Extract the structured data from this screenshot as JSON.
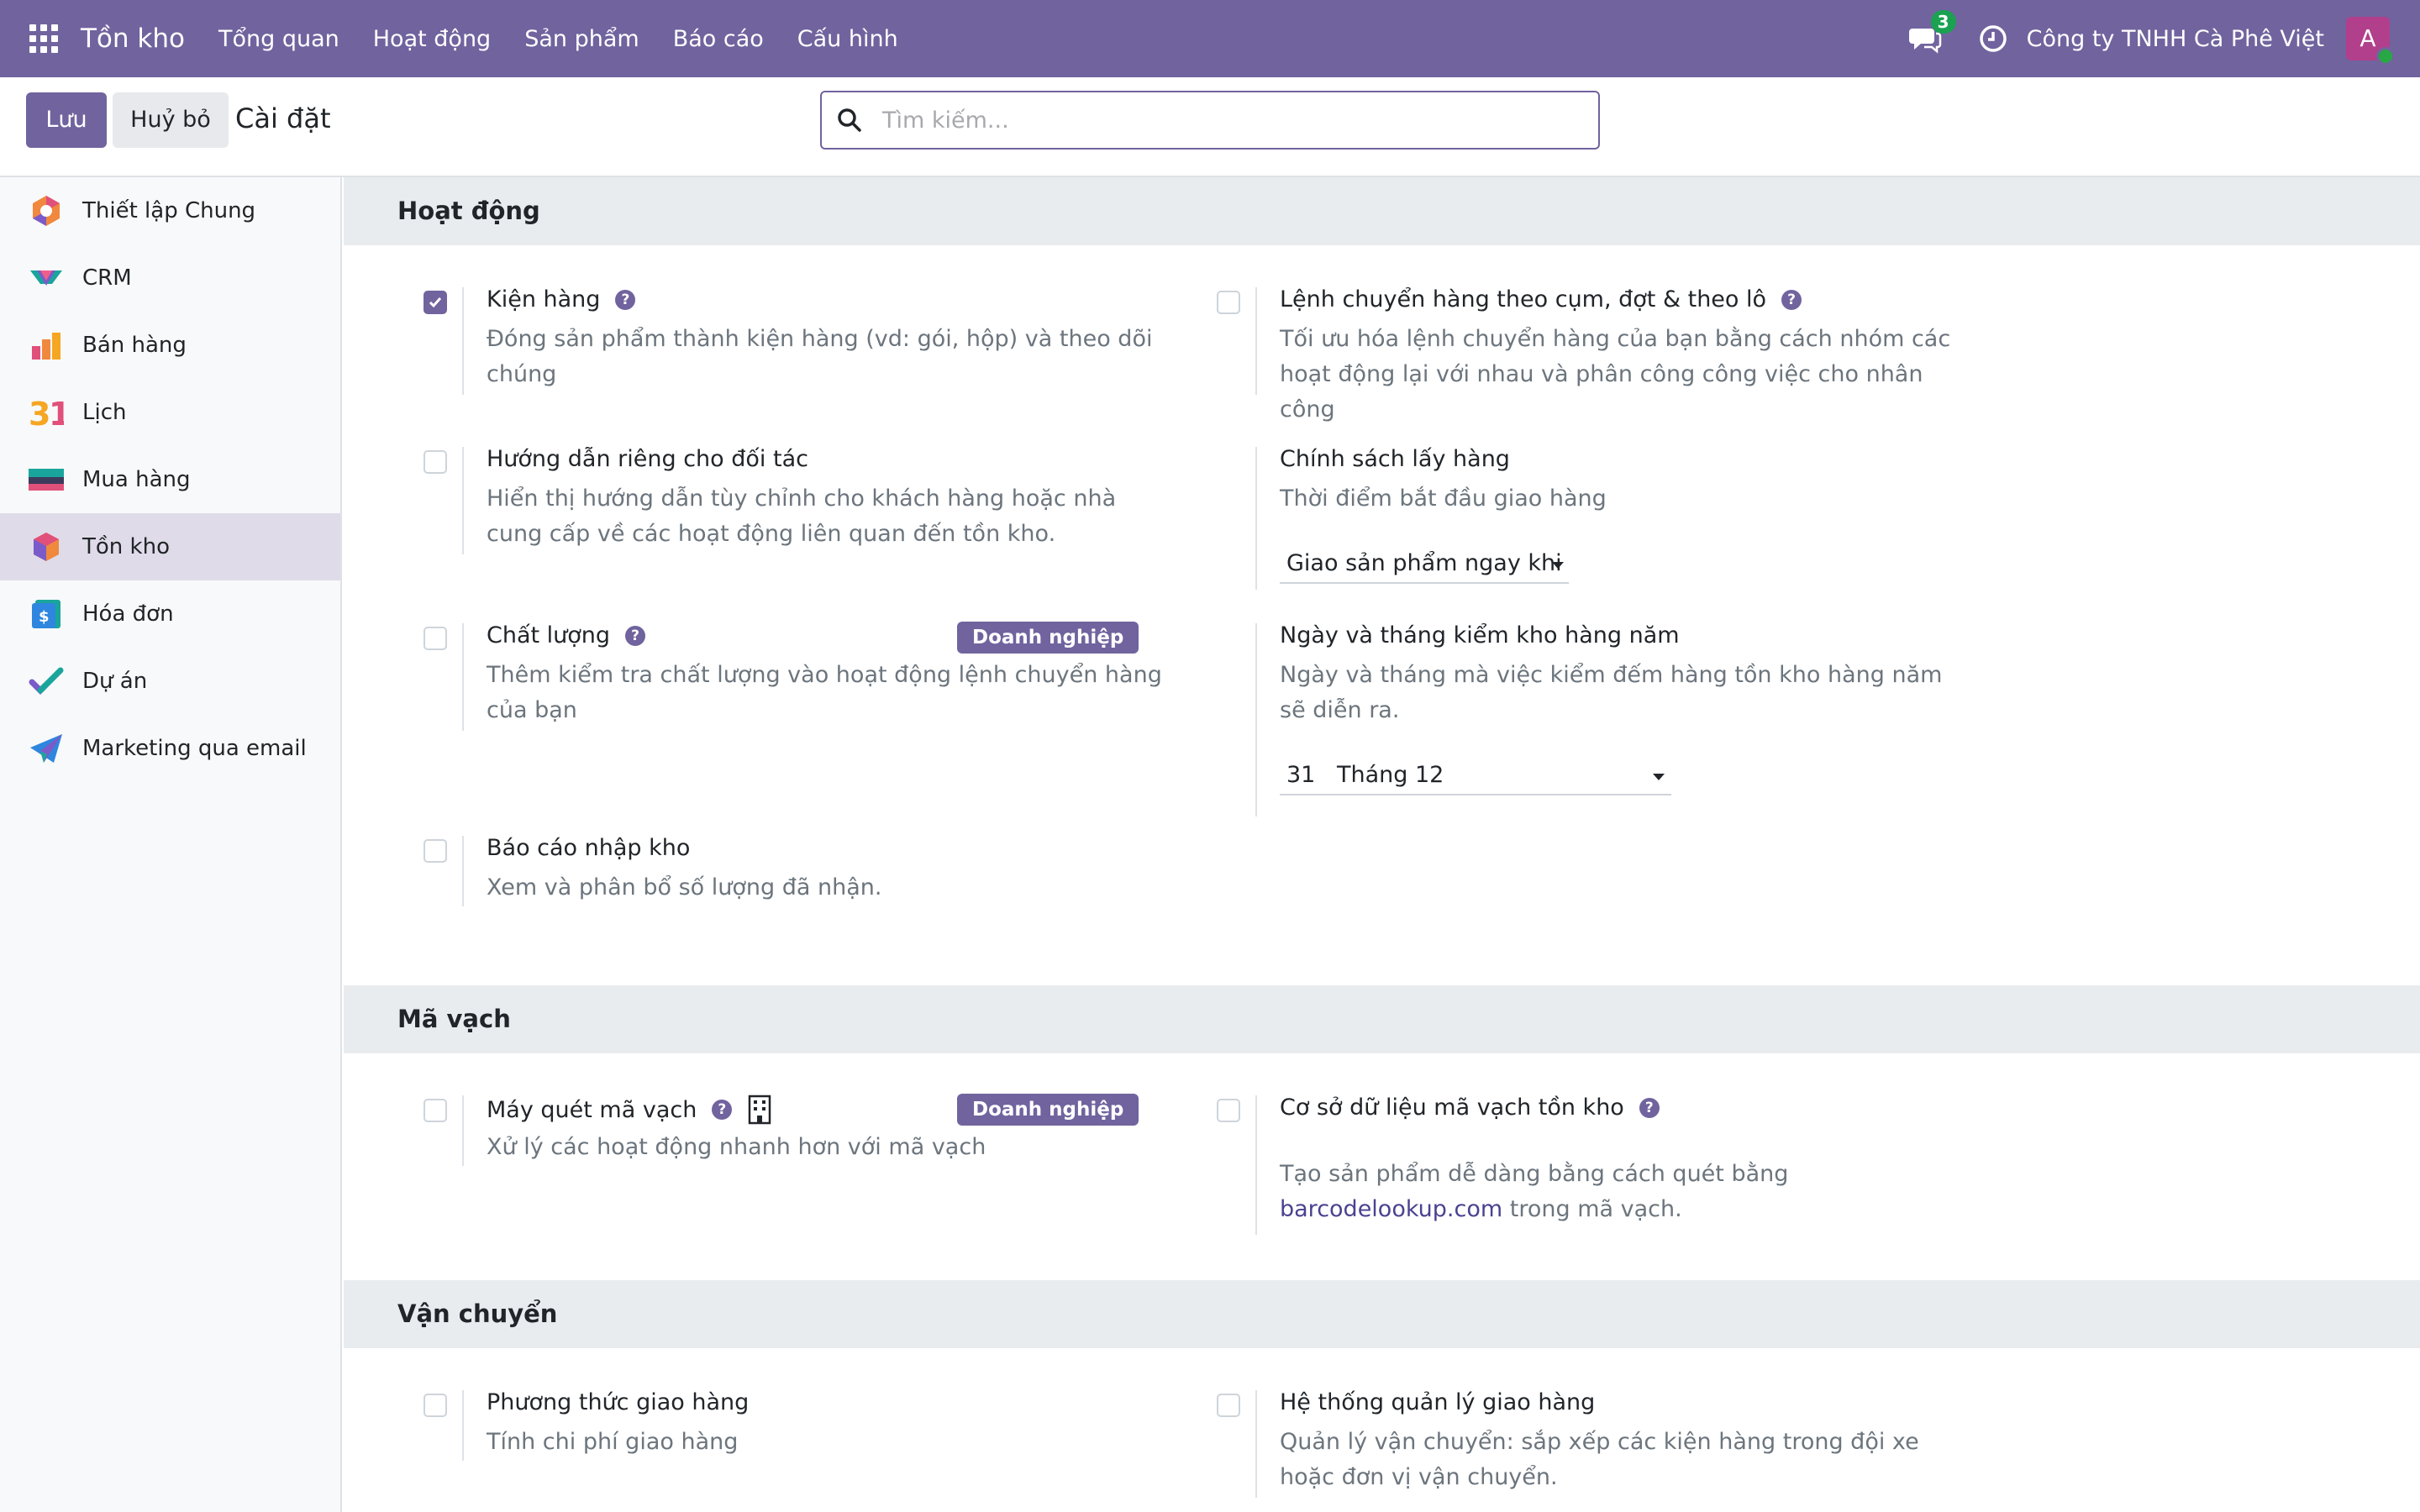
{
  "navbar": {
    "app_name": "Tồn kho",
    "menu": [
      "Tổng quan",
      "Hoạt động",
      "Sản phẩm",
      "Báo cáo",
      "Cấu hình"
    ],
    "chat_count": "3",
    "company": "Công ty TNHH Cà Phê Việt",
    "avatar_letter": "A"
  },
  "control": {
    "save_label": "Lưu",
    "cancel_label": "Huỷ bỏ",
    "breadcrumb": "Cài đặt",
    "search_placeholder": "Tìm kiếm..."
  },
  "sidebar": {
    "items": [
      {
        "label": "Thiết lập Chung",
        "icon": "settings-app-icon"
      },
      {
        "label": "CRM",
        "icon": "crm-app-icon"
      },
      {
        "label": "Bán hàng",
        "icon": "sales-app-icon"
      },
      {
        "label": "Lịch",
        "icon": "calendar-app-icon"
      },
      {
        "label": "Mua hàng",
        "icon": "purchase-app-icon"
      },
      {
        "label": "Tồn kho",
        "icon": "inventory-app-icon",
        "active": true
      },
      {
        "label": "Hóa đơn",
        "icon": "invoice-app-icon"
      },
      {
        "label": "Dự án",
        "icon": "project-app-icon"
      },
      {
        "label": "Marketing qua email",
        "icon": "email-marketing-app-icon"
      }
    ]
  },
  "sections": {
    "operations": {
      "title": "Hoạt động",
      "packages": {
        "title": "Kiện hàng",
        "desc": "Đóng sản phẩm thành kiện hàng (vd: gói, hộp) và theo dõi chúng",
        "checked": true
      },
      "batch": {
        "title": "Lệnh chuyển hàng theo cụm, đợt & theo lô",
        "desc": "Tối ưu hóa lệnh chuyển hàng của bạn bằng cách nhóm các hoạt động lại với nhau và phân công công việc cho nhân công",
        "checked": false
      },
      "partner_instructions": {
        "title": "Hướng dẫn riêng cho đối tác",
        "desc": "Hiển thị hướng dẫn tùy chỉnh cho khách hàng hoặc nhà cung cấp về các hoạt động liên quan đến tồn kho.",
        "checked": false
      },
      "picking_policy": {
        "title": "Chính sách lấy hàng",
        "desc": "Thời điểm bắt đầu giao hàng",
        "value": "Giao sản phẩm ngay khi"
      },
      "quality": {
        "title": "Chất lượng",
        "desc": "Thêm kiểm tra chất lượng vào hoạt động lệnh chuyển hàng của bạn",
        "badge": "Doanh nghiệp",
        "checked": false
      },
      "annual_inventory": {
        "title": "Ngày và tháng kiểm kho hàng năm",
        "desc": "Ngày và tháng mà việc kiểm đếm hàng tồn kho hàng năm sẽ diễn ra.",
        "day": "31",
        "month": "Tháng 12"
      },
      "reception_report": {
        "title": "Báo cáo nhập kho",
        "desc": "Xem và phân bổ số lượng đã nhận.",
        "checked": false
      }
    },
    "barcode": {
      "title": "Mã vạch",
      "scanner": {
        "title": "Máy quét mã vạch",
        "desc": "Xử lý các hoạt động nhanh hơn với mã vạch",
        "badge": "Doanh nghiệp",
        "checked": false
      },
      "database": {
        "title": "Cơ sở dữ liệu mã vạch tồn kho",
        "desc_before": "Tạo sản phẩm dễ dàng bằng cách quét bằng",
        "link": "barcodelookup.com",
        "desc_after": "trong mã vạch.",
        "checked": false
      }
    },
    "shipping": {
      "title": "Vận chuyển",
      "methods": {
        "title": "Phương thức giao hàng",
        "desc": "Tính chi phí giao hàng",
        "checked": false
      },
      "dispatch": {
        "title": "Hệ thống quản lý giao hàng",
        "desc": "Quản lý vận chuyển: sắp xếp các kiện hàng trong đội xe hoặc đơn vị vận chuyển.",
        "checked": false
      }
    }
  },
  "colors": {
    "brand": "#71639e",
    "active_side": "#e0dbe9",
    "section_bg": "#e9ecef"
  }
}
